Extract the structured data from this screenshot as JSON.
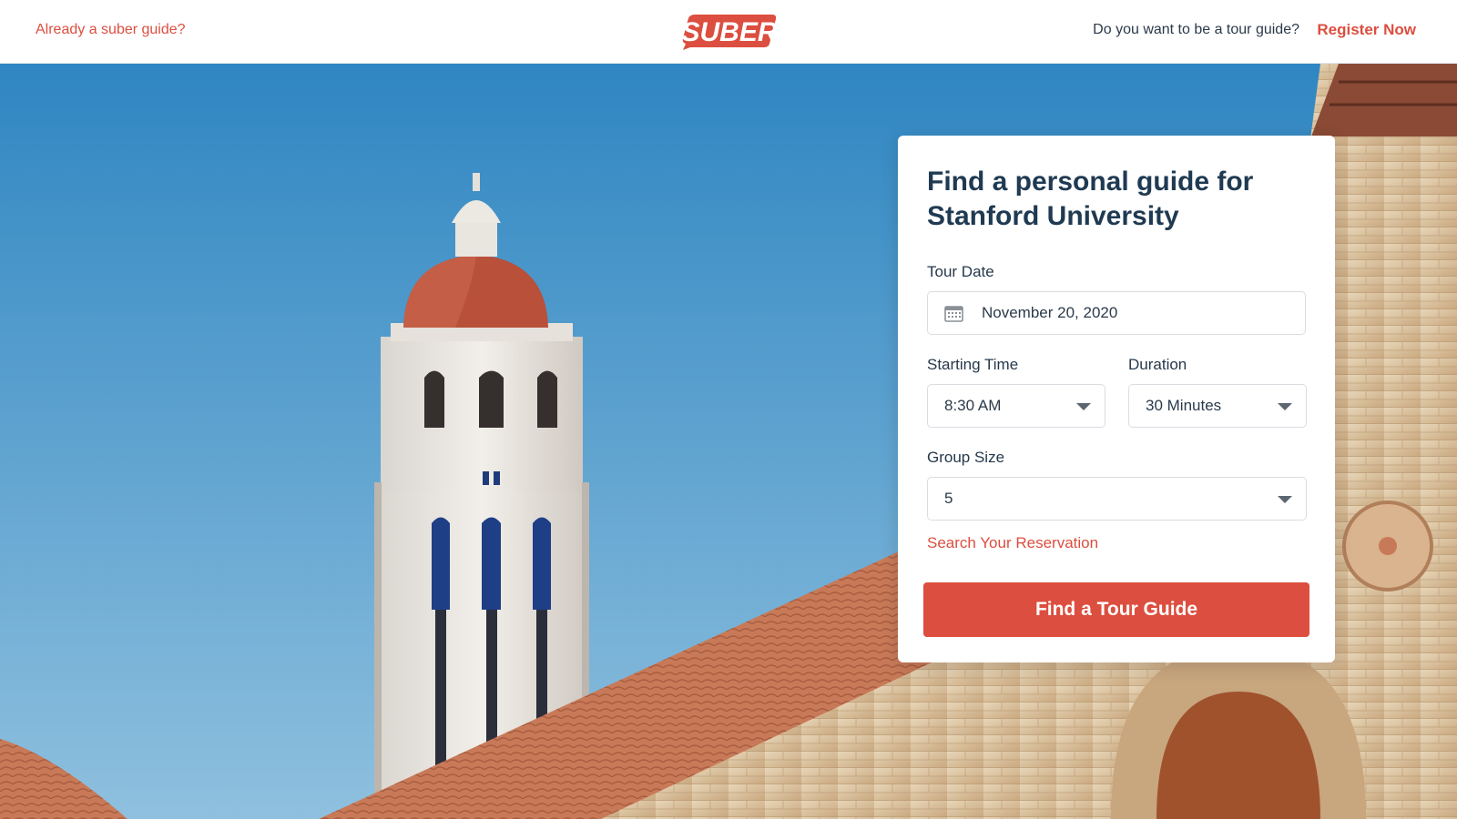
{
  "header": {
    "left_link": "Already a suber guide?",
    "logo_text": "SUBER",
    "question": "Do you want to be a tour guide?",
    "register_link": "Register Now"
  },
  "form": {
    "title": "Find a personal guide for Stanford University",
    "tour_date": {
      "label": "Tour Date",
      "value": "November 20, 2020",
      "icon": "calendar-icon"
    },
    "starting_time": {
      "label": "Starting Time",
      "value": "8:30 AM"
    },
    "duration": {
      "label": "Duration",
      "value": "30 Minutes"
    },
    "group_size": {
      "label": "Group Size",
      "value": "5"
    },
    "search_link": "Search Your Reservation",
    "submit_label": "Find a Tour Guide"
  },
  "colors": {
    "brand": "#dc4e3f",
    "heading": "#1f3a52",
    "sky_top": "#2f86c2",
    "sky_bottom": "#8fc0de"
  }
}
